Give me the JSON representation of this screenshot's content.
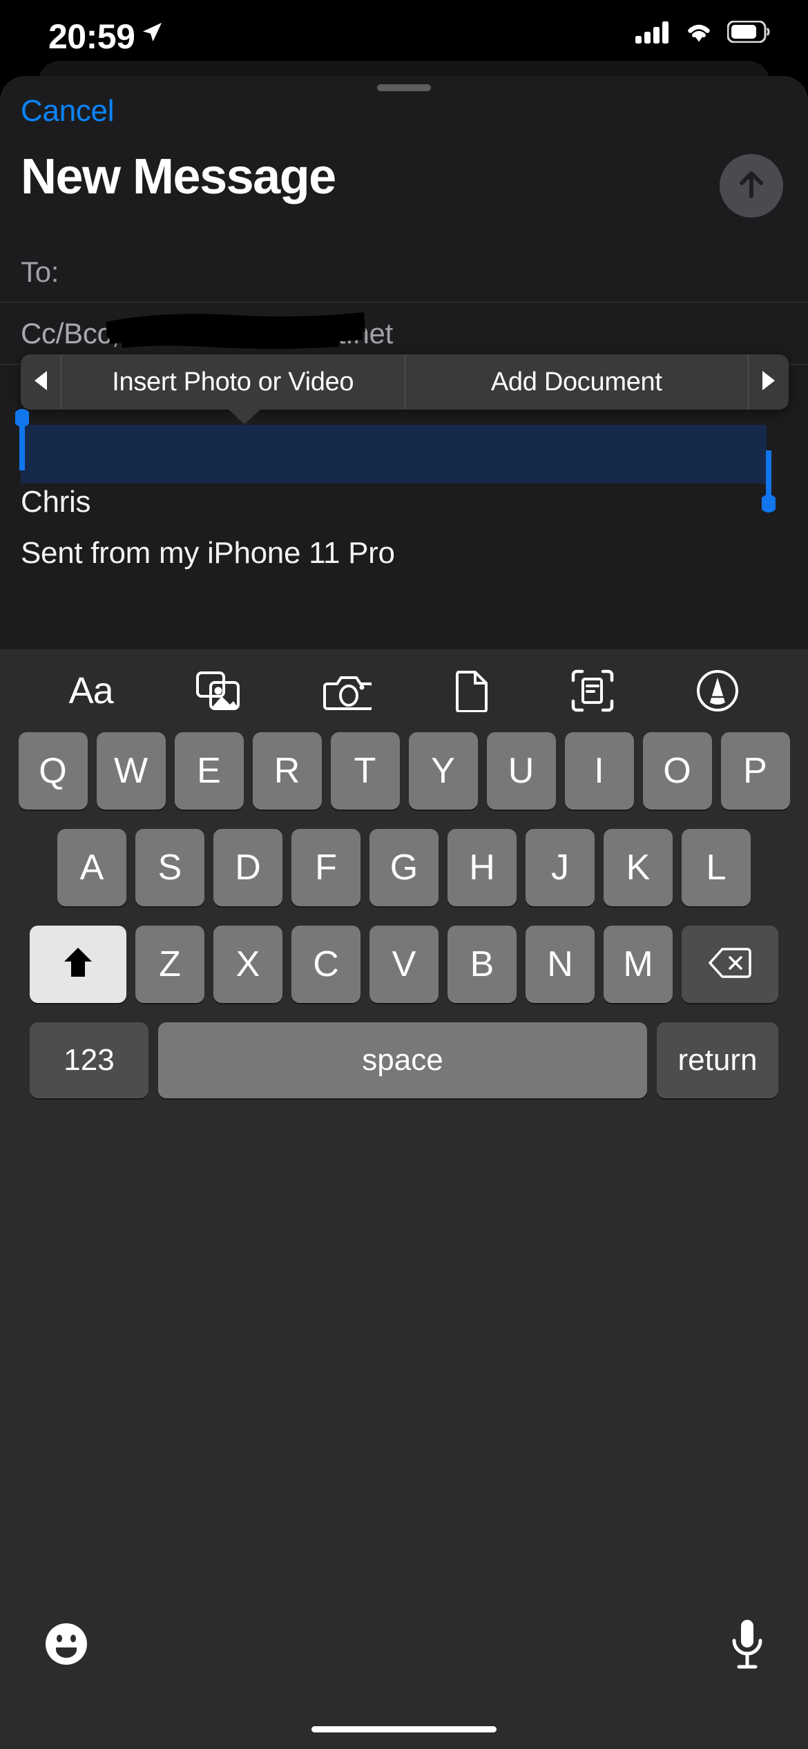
{
  "status_bar": {
    "time": "20:59",
    "location_icon": "location-arrow-icon",
    "cellular_icon": "cellular-signal-icon",
    "wifi_icon": "wifi-icon",
    "battery_icon": "battery-icon"
  },
  "compose": {
    "cancel_label": "Cancel",
    "title": "New Message",
    "send_icon": "arrow-up-icon",
    "send_enabled": false,
    "to_label": "To:",
    "to_value": "",
    "ccbcc_label": "Cc/Bcc, From: ",
    "ccbcc_value": "@comcast.net",
    "ccbcc_redacted": true,
    "body_selection": "",
    "signature_name": "Chris",
    "signature_line": "Sent from my iPhone 11 Pro"
  },
  "context_menu": {
    "prev_icon": "triangle-left-icon",
    "next_icon": "triangle-right-icon",
    "items": [
      {
        "label": "Insert Photo or Video"
      },
      {
        "label": "Add Document"
      }
    ]
  },
  "keyboard": {
    "toolbar": [
      {
        "name": "format-text-icon",
        "label": "Aa"
      },
      {
        "name": "photo-library-icon",
        "label": ""
      },
      {
        "name": "camera-icon",
        "label": ""
      },
      {
        "name": "document-icon",
        "label": ""
      },
      {
        "name": "scan-document-icon",
        "label": ""
      },
      {
        "name": "markup-pen-icon",
        "label": ""
      }
    ],
    "row1": [
      "Q",
      "W",
      "E",
      "R",
      "T",
      "Y",
      "U",
      "I",
      "O",
      "P"
    ],
    "row2": [
      "A",
      "S",
      "D",
      "F",
      "G",
      "H",
      "J",
      "K",
      "L"
    ],
    "row3": [
      "Z",
      "X",
      "C",
      "V",
      "B",
      "N",
      "M"
    ],
    "shift_icon": "shift-arrow-icon",
    "shift_active": true,
    "delete_icon": "backspace-icon",
    "numbers_label": "123",
    "space_label": "space",
    "return_label": "return",
    "emoji_icon": "emoji-smiley-icon",
    "dictation_icon": "microphone-icon"
  },
  "colors": {
    "accent_blue": "#0a84ff",
    "selection_fill": "#17294a",
    "sheet_background": "#1c1c1e",
    "keyboard_background": "#2c2c2e",
    "key_fill": "#787878"
  }
}
